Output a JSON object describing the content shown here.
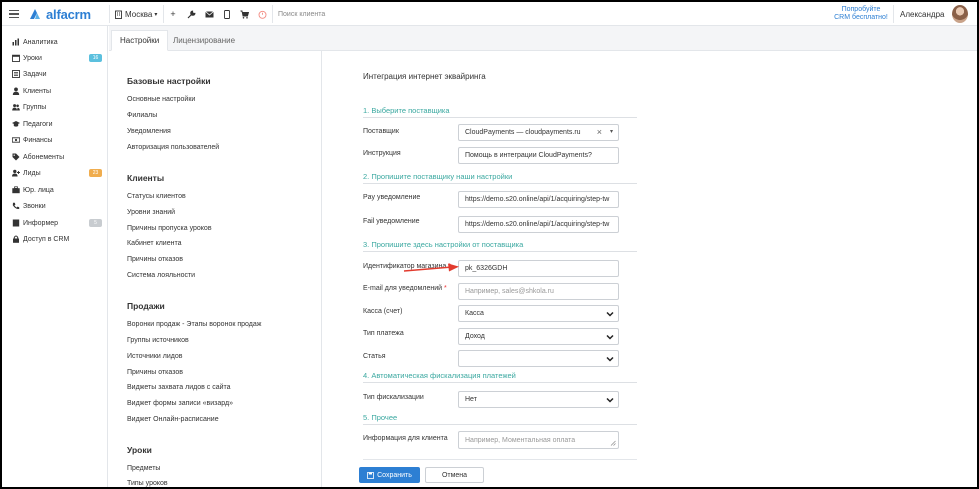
{
  "header": {
    "logo": "alfacrm",
    "city": "Москва",
    "search_placeholder": "Поиск клиента",
    "promo_line1": "Попробуйте",
    "promo_line2": "CRM бесплатно!",
    "username": "Александра"
  },
  "sidebar": {
    "items": [
      {
        "label": "Аналитика",
        "icon": "bar-chart-icon"
      },
      {
        "label": "Уроки",
        "icon": "calendar-icon",
        "badge": "16",
        "badge_color": "#5bc0de"
      },
      {
        "label": "Задачи",
        "icon": "tasks-icon"
      },
      {
        "label": "Клиенты",
        "icon": "user-icon"
      },
      {
        "label": "Группы",
        "icon": "users-icon"
      },
      {
        "label": "Педагоги",
        "icon": "graduation-cap-icon"
      },
      {
        "label": "Финансы",
        "icon": "money-icon"
      },
      {
        "label": "Абонементы",
        "icon": "tag-icon"
      },
      {
        "label": "Лиды",
        "icon": "user-plus-icon",
        "badge": "23",
        "badge_color": "#f0ad4e"
      },
      {
        "label": "Юр. лица",
        "icon": "briefcase-icon"
      },
      {
        "label": "Звонки",
        "icon": "phone-icon"
      },
      {
        "label": "Информер",
        "icon": "informer-icon",
        "badge": "5",
        "badge_color": "#c8ccd0"
      },
      {
        "label": "Доступ в CRM",
        "icon": "lock-icon"
      }
    ]
  },
  "tabs": [
    {
      "label": "Настройки",
      "active": true
    },
    {
      "label": "Лицензирование",
      "active": false
    }
  ],
  "menu": {
    "sections": [
      {
        "title": "Базовые настройки",
        "links": [
          "Основные настройки",
          "Филиалы",
          "Уведомления",
          "Авторизация пользователей"
        ]
      },
      {
        "title": "Клиенты",
        "links": [
          "Статусы клиентов",
          "Уровни знаний",
          "Причины пропуска уроков",
          "Кабинет клиента",
          "Причины отказов",
          "Система лояльности"
        ]
      },
      {
        "title": "Продажи",
        "links": [
          "Воронки продаж - Этапы воронок продаж",
          "Группы источников",
          "Источники лидов",
          "Причины отказов",
          "Виджеты захвата лидов с сайта",
          "Виджет формы записи «визард»",
          "Виджет Онлайн-расписание"
        ]
      },
      {
        "title": "Уроки",
        "links": [
          "Предметы",
          "Типы уроков"
        ]
      }
    ]
  },
  "form": {
    "title": "Интеграция интернет эквайринга",
    "sections": [
      "1. Выберите поставщика",
      "2. Пропишите поставщику наши настройки",
      "3. Пропишите здесь настройки от поставщика",
      "4. Автоматическая фискализация платежей",
      "5. Прочее"
    ],
    "fields": {
      "provider_label": "Поставщик",
      "provider_value": "CloudPayments — cloudpayments.ru",
      "instruction_label": "Инструкция",
      "instruction_value": "Помощь в интеграции CloudPayments?",
      "pay_label": "Pay уведомление",
      "pay_value": "https://demo.s20.online/api/1/acquiring/step-tw",
      "fail_label": "Fail уведомление",
      "fail_value": "https://demo.s20.online/api/1/acquiring/step-tw",
      "shop_id_label": "Идентификатор магазина",
      "shop_id_value": "pk_6326GDH",
      "email_label": "E-mail для уведомлений",
      "email_placeholder": "Например, sales@shkola.ru",
      "cashbox_label": "Касса (счет)",
      "cashbox_value": "Касса",
      "payment_type_label": "Тип платежа",
      "payment_type_value": "Доход",
      "article_label": "Статья",
      "article_value": "",
      "fiscal_type_label": "Тип фискализации",
      "fiscal_type_value": "Нет",
      "client_info_label": "Информация для клиента",
      "client_info_placeholder": "Например, Моментальная оплата",
      "required_mark": "*"
    },
    "save_label": "Сохранить",
    "cancel_label": "Отмена"
  },
  "colors": {
    "accent": "#2d7fd3",
    "section": "#3aa8a0",
    "required": "#e33333",
    "annotation_arrow": "#e23b2e"
  }
}
